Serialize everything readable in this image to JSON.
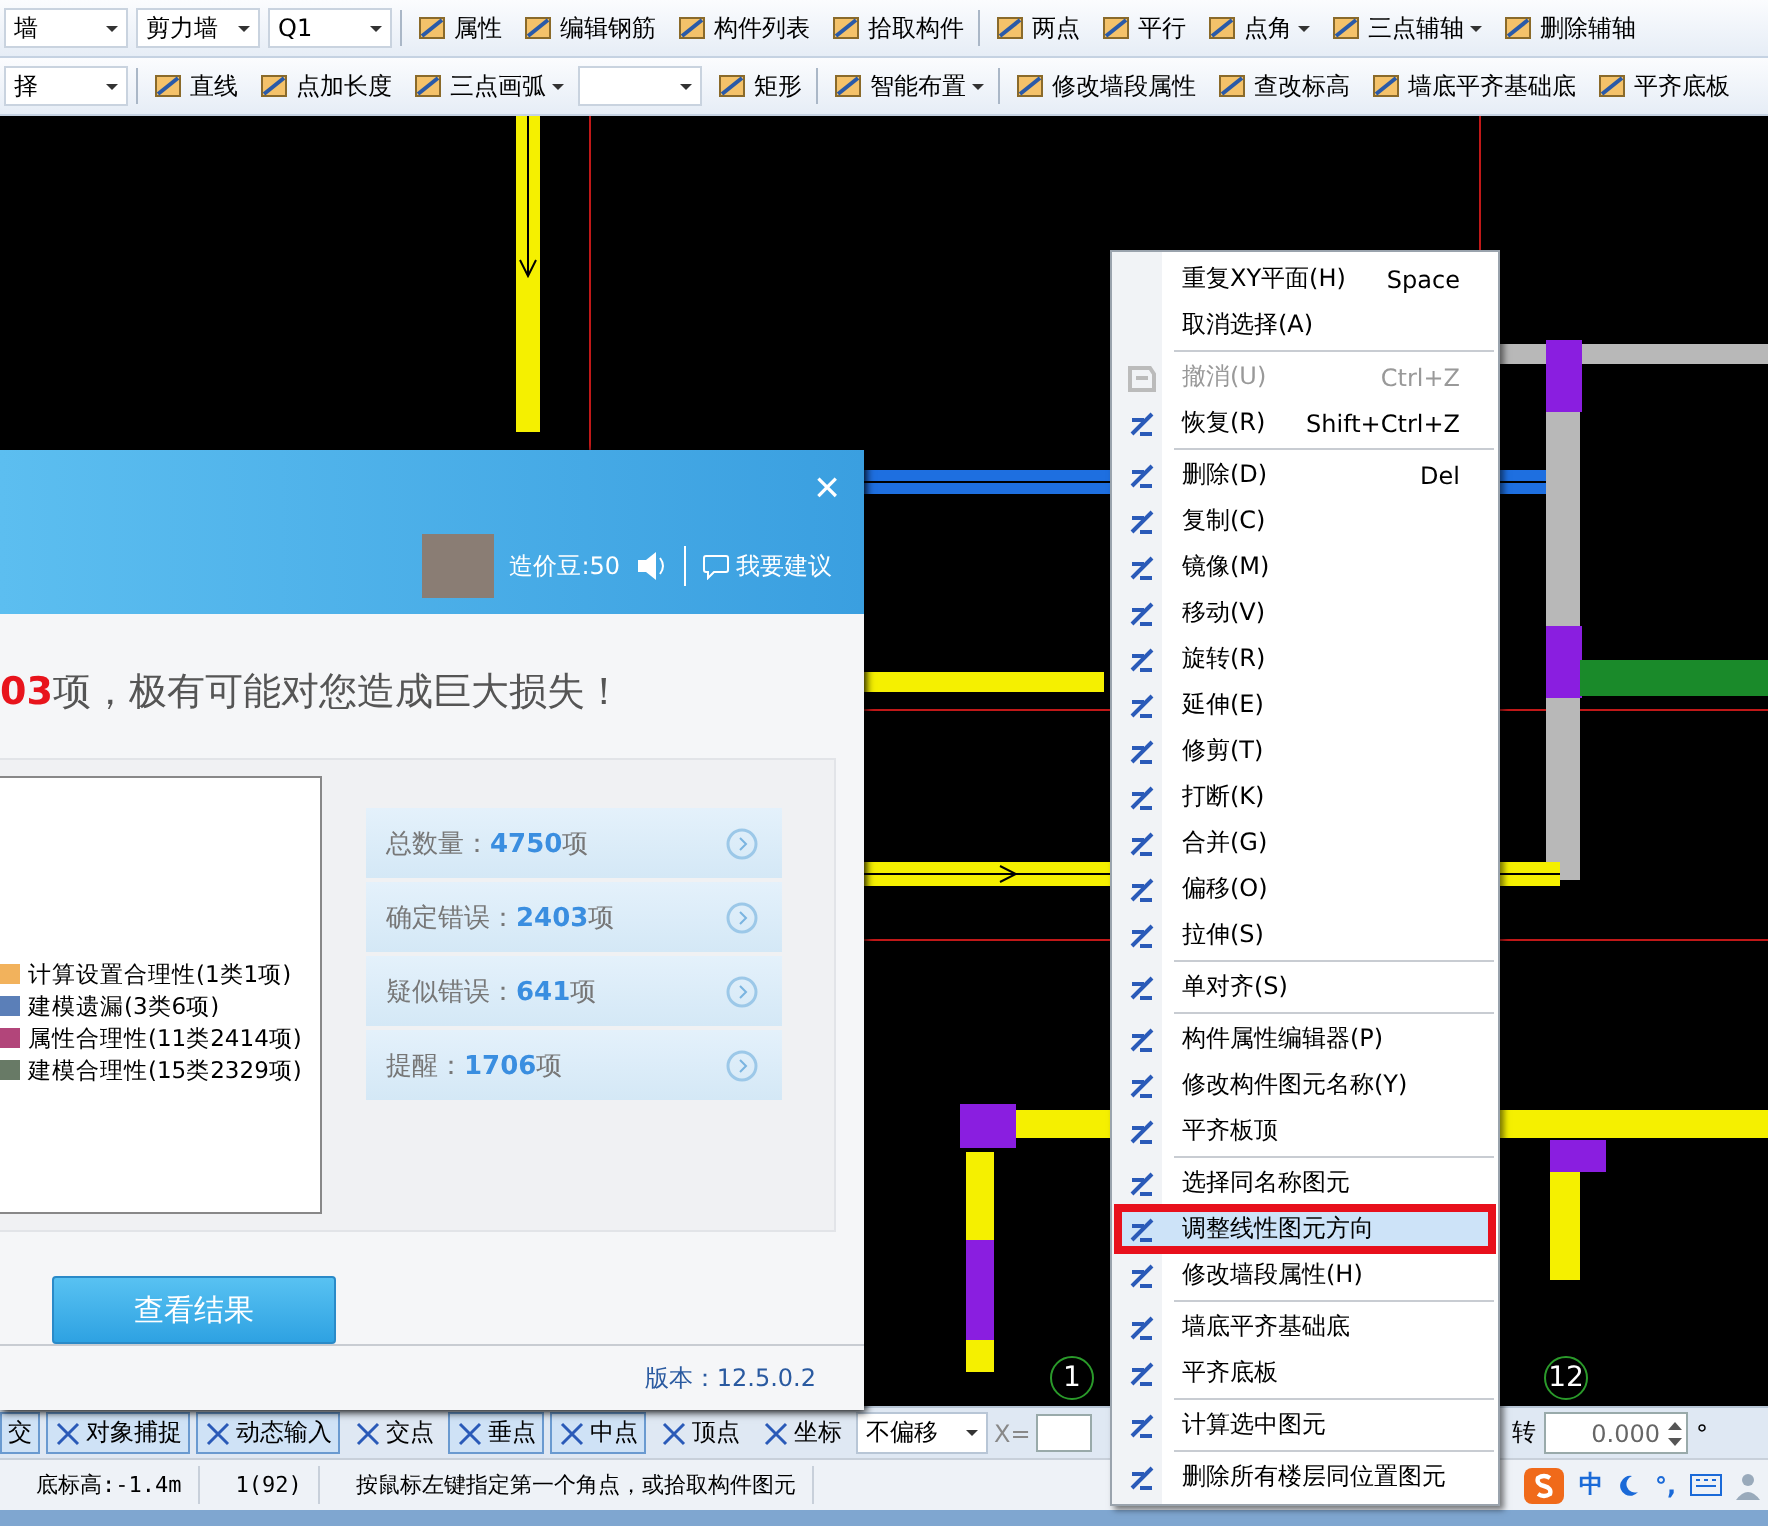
{
  "toolbar_1": [
    {
      "kind": "select",
      "value": "墙"
    },
    {
      "kind": "select",
      "value": "剪力墙"
    },
    {
      "kind": "select",
      "value": "Q1"
    },
    {
      "kind": "separator"
    },
    {
      "kind": "button",
      "label": "属性"
    },
    {
      "kind": "button",
      "label": "编辑钢筋"
    },
    {
      "kind": "button",
      "label": "构件列表"
    },
    {
      "kind": "button",
      "label": "拾取构件"
    },
    {
      "kind": "separator"
    },
    {
      "kind": "button",
      "label": "两点"
    },
    {
      "kind": "button",
      "label": "平行"
    },
    {
      "kind": "menu_button",
      "label": "点角"
    },
    {
      "kind": "menu_button",
      "label": "三点辅轴"
    },
    {
      "kind": "button",
      "label": "删除辅轴"
    }
  ],
  "toolbar_2": [
    {
      "kind": "select",
      "value": "择"
    },
    {
      "kind": "separator"
    },
    {
      "kind": "button",
      "label": "直线"
    },
    {
      "kind": "button",
      "label": "点加长度"
    },
    {
      "kind": "menu_button",
      "label": "三点画弧"
    },
    {
      "kind": "select"
    },
    {
      "kind": "button",
      "label": "矩形"
    },
    {
      "kind": "separator"
    },
    {
      "kind": "menu_button",
      "label": "智能布置"
    },
    {
      "kind": "separator"
    },
    {
      "kind": "button",
      "label": "修改墙段属性"
    },
    {
      "kind": "button",
      "label": "查改标高"
    },
    {
      "kind": "button",
      "label": "墙底平齐基础底"
    },
    {
      "kind": "button",
      "label": "平齐底板"
    }
  ],
  "canvas": {
    "axis_labels": [
      "1",
      "12"
    ]
  },
  "check_dialog": {
    "close": "×",
    "user_points": "造价豆:50",
    "suggest_link": "我要建议",
    "headline": "**03**项，极有可能对您造成巨大损失！",
    "legend": [
      {
        "label": "计算设置合理性(1类1项)",
        "color": "#f2b25c"
      },
      {
        "label": "建模遗漏(3类6项)",
        "color": "#5b7fb8"
      },
      {
        "label": "属性合理性(11类2414项)",
        "color": "#b2457a"
      },
      {
        "label": "建模合理性(15类2329项)",
        "color": "#687a66"
      }
    ],
    "stats": [
      "总数量：**4750**项",
      "确定错误：**2403**项",
      "疑似错误：**641**项",
      "提醒：**1706**项"
    ],
    "button": "查看结果",
    "version": "版本：12.5.0.2"
  },
  "context_menu": [
    {
      "kind": "item",
      "label": "重复XY平面(H)",
      "shortcut": "Space",
      "disabled": false,
      "selected": false,
      "marked": false
    },
    {
      "kind": "item",
      "label": "取消选择(A)",
      "disabled": false,
      "selected": false,
      "marked": false
    },
    {
      "kind": "separator"
    },
    {
      "kind": "icon_item",
      "label": "撤消(U)",
      "shortcut": "Ctrl+Z",
      "disabled": true,
      "selected": false,
      "marked": false
    },
    {
      "kind": "icon_item",
      "label": "恢复(R)",
      "shortcut": "Shift+Ctrl+Z",
      "disabled": false,
      "selected": false,
      "marked": false
    },
    {
      "kind": "separator"
    },
    {
      "kind": "icon_item",
      "label": "删除(D)",
      "shortcut": "Del",
      "disabled": false,
      "selected": false,
      "marked": false
    },
    {
      "kind": "icon_item",
      "label": "复制(C)",
      "disabled": false,
      "selected": false,
      "marked": false
    },
    {
      "kind": "icon_item",
      "label": "镜像(M)",
      "disabled": false,
      "selected": false,
      "marked": false
    },
    {
      "kind": "icon_item",
      "label": "移动(V)",
      "disabled": false,
      "selected": false,
      "marked": false
    },
    {
      "kind": "icon_item",
      "label": "旋转(R)",
      "disabled": false,
      "selected": false,
      "marked": false
    },
    {
      "kind": "icon_item",
      "label": "延伸(E)",
      "disabled": false,
      "selected": false,
      "marked": false
    },
    {
      "kind": "icon_item",
      "label": "修剪(T)",
      "disabled": false,
      "selected": false,
      "marked": false
    },
    {
      "kind": "icon_item",
      "label": "打断(K)",
      "disabled": false,
      "selected": false,
      "marked": false
    },
    {
      "kind": "icon_item",
      "label": "合并(G)",
      "disabled": false,
      "selected": false,
      "marked": false
    },
    {
      "kind": "icon_item",
      "label": "偏移(O)",
      "disabled": false,
      "selected": false,
      "marked": false
    },
    {
      "kind": "icon_item",
      "label": "拉伸(S)",
      "disabled": false,
      "selected": false,
      "marked": false
    },
    {
      "kind": "separator"
    },
    {
      "kind": "icon_item",
      "label": "单对齐(S)",
      "disabled": false,
      "selected": false,
      "marked": false
    },
    {
      "kind": "separator"
    },
    {
      "kind": "icon_item",
      "label": "构件属性编辑器(P)",
      "disabled": false,
      "selected": false,
      "marked": false
    },
    {
      "kind": "icon_item",
      "label": "修改构件图元名称(Y)",
      "disabled": false,
      "selected": false,
      "marked": false
    },
    {
      "kind": "icon_item",
      "label": "平齐板顶",
      "disabled": false,
      "selected": false,
      "marked": false
    },
    {
      "kind": "separator"
    },
    {
      "kind": "icon_item",
      "label": "选择同名称图元",
      "disabled": false,
      "selected": false,
      "marked": false
    },
    {
      "kind": "icon_item",
      "label": "调整线性图元方向",
      "disabled": false,
      "selected": true,
      "marked": true
    },
    {
      "kind": "icon_item",
      "label": "修改墙段属性(H)",
      "disabled": false,
      "selected": false,
      "marked": false
    },
    {
      "kind": "separator"
    },
    {
      "kind": "icon_item",
      "label": "墙底平齐基础底",
      "disabled": false,
      "selected": false,
      "marked": false
    },
    {
      "kind": "icon_item",
      "label": "平齐底板",
      "disabled": false,
      "selected": false,
      "marked": false
    },
    {
      "kind": "separator"
    },
    {
      "kind": "icon_item",
      "label": "计算选中图元",
      "disabled": false,
      "selected": false,
      "marked": false
    },
    {
      "kind": "separator"
    },
    {
      "kind": "icon_item",
      "label": "删除所有楼层同位置图元",
      "disabled": false,
      "selected": false,
      "marked": false
    }
  ],
  "snap_bar": {
    "toggles": [
      {
        "label": "交",
        "on": true
      },
      {
        "label": "对象捕捉",
        "on": true
      },
      {
        "label": "动态输入",
        "on": true
      },
      {
        "label": "交点",
        "on": false
      },
      {
        "label": "垂点",
        "on": true
      },
      {
        "label": "中点",
        "on": true
      },
      {
        "label": "顶点",
        "on": false
      },
      {
        "label": "坐标",
        "on": false
      }
    ],
    "offset_select": "不偏移",
    "x_label": "X=",
    "rotate_label": "转",
    "rotate_value": "0.000",
    "degree": "°"
  },
  "status_bar": {
    "cells": [
      "底标高:-1.4m",
      "1(92)",
      "按鼠标左键指定第一个角点，或拾取构件图元"
    ],
    "ime_mode": "中",
    "ime_punct": "°,"
  }
}
